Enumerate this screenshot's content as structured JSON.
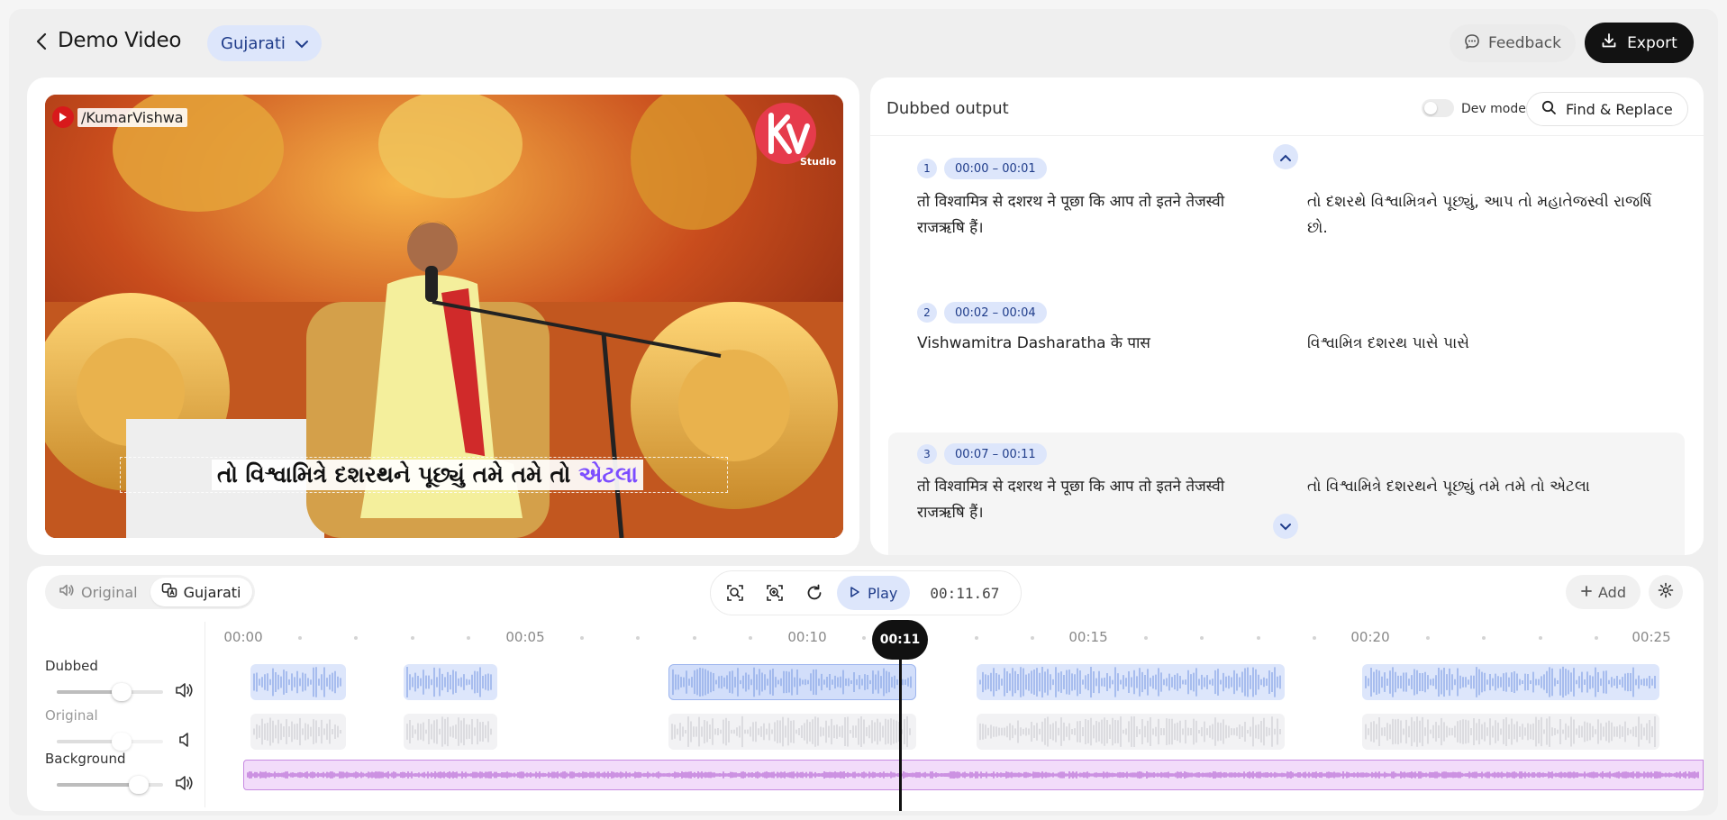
{
  "header": {
    "title": "Demo Video",
    "language": "Gujarati",
    "feedback_label": "Feedback",
    "export_label": "Export"
  },
  "video": {
    "channel_tag": "/KumarVishwa",
    "logo_text": "Studio",
    "subtitle_text": "તો વિશ્વામિત્રે દશરથને પૂછ્યું તમે તમે તો",
    "subtitle_highlight": "એટલા",
    "subtitle_highlight_color": "#7c4dff"
  },
  "output": {
    "title": "Dubbed output",
    "dev_mode_label": "Dev mode",
    "dev_mode_on": false,
    "find_replace_label": "Find & Replace",
    "segments": [
      {
        "num": "1",
        "time": "00:00 – 00:01",
        "source": "तो विश्वामित्र से दशरथ ने पूछा कि आप तो इतने तेजस्वी राजऋषि हैं।",
        "dubbed": "તો દશરથે વિશ્વામિત્રને પૂછ્યું, આપ તો મહાતેજસ્વી રાજર્ષિ છો."
      },
      {
        "num": "2",
        "time": "00:02 – 00:04",
        "source": "Vishwamitra Dasharatha के पास",
        "dubbed": "વિશ્વામિત્ર દશરથ પાસે પાસે"
      },
      {
        "num": "3",
        "time": "00:07 – 00:11",
        "source": "तो विश्वामित्र से दशरथ ने पूछा कि आप तो इतने तेजस्वी राजऋषि हैं।",
        "dubbed": "તો વિશ્વામિત્રે દશરથને પૂછ્યું તમે તમે તો એટલા"
      }
    ]
  },
  "timeline": {
    "track_toggle": [
      "Original",
      "Gujarati"
    ],
    "active_track": "Gujarati",
    "play_label": "Play",
    "current_time": "00:11.67",
    "playhead_label": "00:11",
    "playhead_seconds": 11.67,
    "add_label": "Add",
    "ruler_labels": [
      "00:00",
      "00:05",
      "00:10",
      "00:15",
      "00:20",
      "00:25"
    ],
    "tracks": [
      {
        "name": "Dubbed",
        "volume": 0.6,
        "muted": false
      },
      {
        "name": "Original",
        "volume": 0.6,
        "muted": true
      },
      {
        "name": "Background",
        "volume": 0.75,
        "muted": false
      }
    ],
    "colors": {
      "dubbed": "#dde6fb",
      "original": "#f2f2f4",
      "background": "#f2dcfa",
      "accent": "#1f3c8a"
    }
  }
}
